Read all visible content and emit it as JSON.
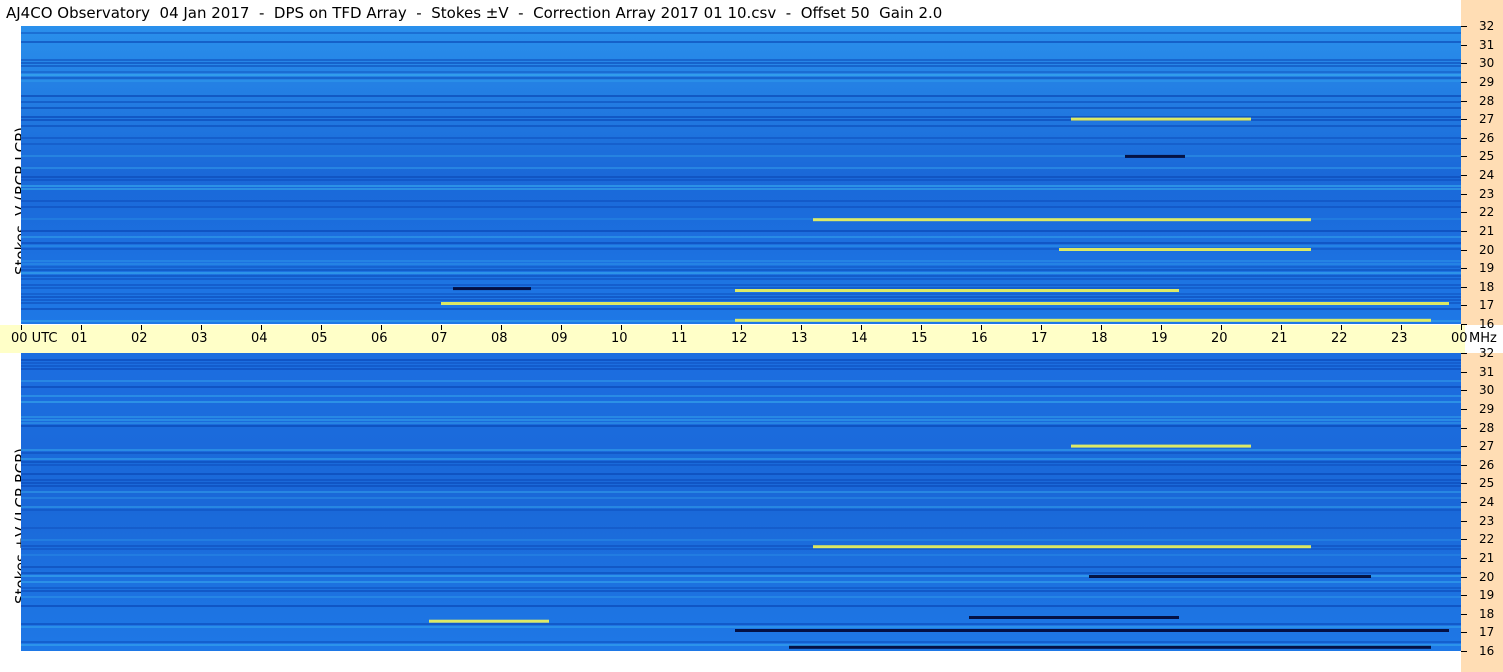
{
  "title": "AJ4CO Observatory  04 Jan 2017  -  DPS on TFD Array  -  Stokes ±V  -  Correction Array 2017 01 10.csv  -  Offset 50  Gain 2.0",
  "colors": {
    "background_blue": "#1e78e6",
    "deep_blue": "#0a46b4",
    "light_band": "#3cb4f0",
    "hot_burst": "#ffff50",
    "dark_burst": "#000028",
    "time_axis_bg": "#ffffc8",
    "freq_axis_bg": "#ffddb4"
  },
  "chart_data": [
    {
      "type": "heatmap",
      "panel": "top",
      "ylabel": "Stokes -V (RCP-LCP)",
      "x_ticks": [
        "00 UTC",
        "01",
        "02",
        "03",
        "04",
        "05",
        "06",
        "07",
        "08",
        "09",
        "10",
        "11",
        "12",
        "13",
        "14",
        "15",
        "16",
        "17",
        "18",
        "19",
        "20",
        "21",
        "22",
        "23",
        "00"
      ],
      "xlim_hours": [
        0,
        24
      ],
      "y_ticks": [
        32,
        31,
        30,
        29,
        28,
        27,
        26,
        25,
        24,
        23,
        22,
        21,
        20,
        19,
        18,
        17,
        16
      ],
      "ylim_mhz": [
        16,
        32
      ],
      "emission_features": [
        {
          "mhz": 17.8,
          "start_hr": 11.9,
          "end_hr": 19.3,
          "kind": "bright"
        },
        {
          "mhz": 17.1,
          "start_hr": 7.0,
          "end_hr": 23.8,
          "kind": "bright"
        },
        {
          "mhz": 16.2,
          "start_hr": 11.9,
          "end_hr": 23.5,
          "kind": "bright"
        },
        {
          "mhz": 20.0,
          "start_hr": 17.3,
          "end_hr": 21.5,
          "kind": "bright"
        },
        {
          "mhz": 21.6,
          "start_hr": 13.2,
          "end_hr": 21.5,
          "kind": "bright"
        },
        {
          "mhz": 25.0,
          "start_hr": 18.4,
          "end_hr": 19.4,
          "kind": "dark"
        },
        {
          "mhz": 27.0,
          "start_hr": 17.5,
          "end_hr": 20.5,
          "kind": "bright"
        },
        {
          "mhz": 17.9,
          "start_hr": 7.2,
          "end_hr": 8.5,
          "kind": "dark"
        }
      ]
    },
    {
      "type": "heatmap",
      "panel": "bottom",
      "ylabel": "Stokes +V (LCP-RCP)",
      "x_ticks": [
        "00 UTC",
        "01",
        "02",
        "03",
        "04",
        "05",
        "06",
        "07",
        "08",
        "09",
        "10",
        "11",
        "12",
        "13",
        "14",
        "15",
        "16",
        "17",
        "18",
        "19",
        "20",
        "21",
        "22",
        "23",
        "00"
      ],
      "xlim_hours": [
        0,
        24
      ],
      "y_ticks": [
        32,
        31,
        30,
        29,
        28,
        27,
        26,
        25,
        24,
        23,
        22,
        21,
        20,
        19,
        18,
        17,
        16
      ],
      "ylim_mhz": [
        16,
        32
      ],
      "emission_features": [
        {
          "mhz": 17.8,
          "start_hr": 15.8,
          "end_hr": 19.3,
          "kind": "dark"
        },
        {
          "mhz": 17.1,
          "start_hr": 11.9,
          "end_hr": 23.8,
          "kind": "dark"
        },
        {
          "mhz": 16.2,
          "start_hr": 12.8,
          "end_hr": 23.5,
          "kind": "dark"
        },
        {
          "mhz": 20.0,
          "start_hr": 17.8,
          "end_hr": 22.5,
          "kind": "dark"
        },
        {
          "mhz": 21.6,
          "start_hr": 13.2,
          "end_hr": 21.5,
          "kind": "bright"
        },
        {
          "mhz": 27.0,
          "start_hr": 17.5,
          "end_hr": 20.5,
          "kind": "bright"
        },
        {
          "mhz": 17.6,
          "start_hr": 6.8,
          "end_hr": 8.8,
          "kind": "bright"
        }
      ]
    }
  ],
  "freq_unit": "MHz"
}
